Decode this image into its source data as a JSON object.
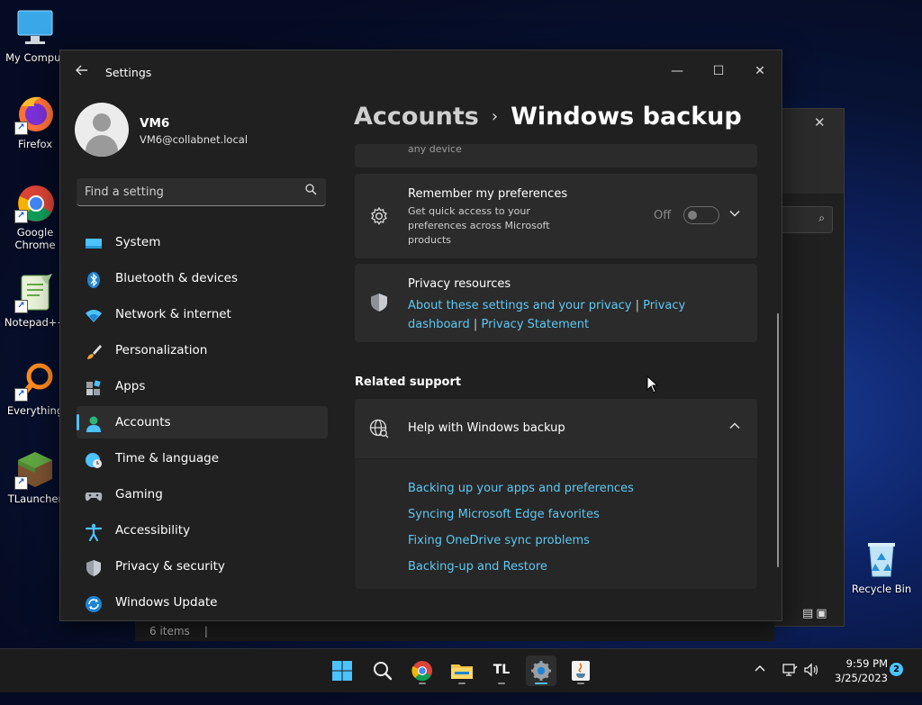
{
  "desktop": {
    "icons": [
      {
        "label": "My Comput"
      },
      {
        "label": "Firefox"
      },
      {
        "label": "Google Chrome"
      },
      {
        "label": "Notepad++"
      },
      {
        "label": "Everything"
      },
      {
        "label": "TLauncher"
      }
    ],
    "recycle_bin": "Recycle Bin"
  },
  "background_window": {
    "status": "6 items"
  },
  "settings": {
    "title": "Settings",
    "user": {
      "name": "VM6",
      "email": "VM6@collabnet.local"
    },
    "search": {
      "placeholder": "Find a setting"
    },
    "nav": [
      {
        "label": "System",
        "icon": "monitor-icon"
      },
      {
        "label": "Bluetooth & devices",
        "icon": "bluetooth-icon"
      },
      {
        "label": "Network & internet",
        "icon": "wifi-icon"
      },
      {
        "label": "Personalization",
        "icon": "paintbrush-icon"
      },
      {
        "label": "Apps",
        "icon": "apps-icon"
      },
      {
        "label": "Accounts",
        "icon": "accounts-icon",
        "active": true
      },
      {
        "label": "Time & language",
        "icon": "clock-globe-icon"
      },
      {
        "label": "Gaming",
        "icon": "gamepad-icon"
      },
      {
        "label": "Accessibility",
        "icon": "accessibility-icon"
      },
      {
        "label": "Privacy & security",
        "icon": "shield-icon"
      },
      {
        "label": "Windows Update",
        "icon": "update-icon"
      }
    ],
    "breadcrumb": {
      "parent": "Accounts",
      "separator": "›",
      "current": "Windows backup"
    },
    "top_card_clipped": "any device",
    "preferences": {
      "title": "Remember my preferences",
      "description": "Get quick access to your preferences across Microsoft products",
      "toggle_label": "Off",
      "toggle_on": false
    },
    "privacy": {
      "title": "Privacy resources",
      "links": [
        "About these settings and your privacy",
        "Privacy dashboard",
        "Privacy Statement"
      ],
      "separator": "|"
    },
    "related_support": {
      "label": "Related support",
      "help_title": "Help with Windows backup",
      "links": [
        "Backing up your apps and preferences",
        "Syncing Microsoft Edge favorites",
        "Fixing OneDrive sync problems",
        "Backing-up and Restore"
      ]
    }
  },
  "taskbar": {
    "apps": [
      "start-icon",
      "search-icon",
      "chrome-icon",
      "file-explorer-icon",
      "tlauncher-icon",
      "settings-icon",
      "java-icon"
    ],
    "tlauncher_text": "TL",
    "time": "9:59 PM",
    "date": "3/25/2023",
    "notification_count": "2"
  },
  "colors": {
    "accent": "#4cc2ff",
    "link": "#5fc8f2",
    "window_bg": "#202020",
    "card_bg": "#2b2b2b"
  }
}
